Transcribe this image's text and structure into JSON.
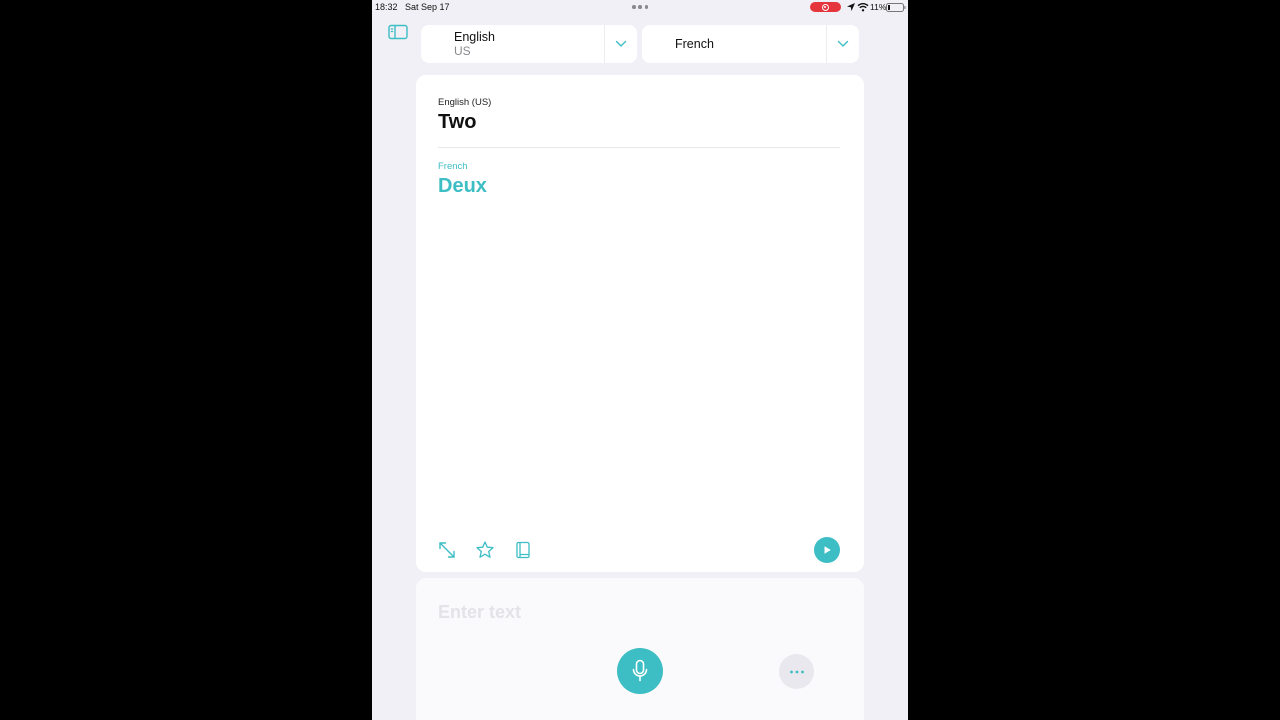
{
  "status_bar": {
    "time": "18:32",
    "date": "Sat Sep 17",
    "battery": "11%",
    "recording_color": "#e5363d"
  },
  "source_language": {
    "name": "English",
    "region": "US"
  },
  "target_language": {
    "name": "French"
  },
  "translation": {
    "source_label": "English (US)",
    "source_text": "Two",
    "target_label": "French",
    "target_text": "Deux"
  },
  "input": {
    "placeholder": "Enter text"
  },
  "icons": {
    "sidebar": "sidebar-icon",
    "chevron": "chevron-down-icon",
    "expand": "expand-icon",
    "favorite": "star-icon",
    "dictionary": "book-icon",
    "play": "play-icon",
    "mic": "microphone-icon",
    "more": "ellipsis-icon"
  },
  "colors": {
    "accent": "#3dbdc4",
    "background": "#f1f0f6",
    "card": "#ffffff"
  }
}
